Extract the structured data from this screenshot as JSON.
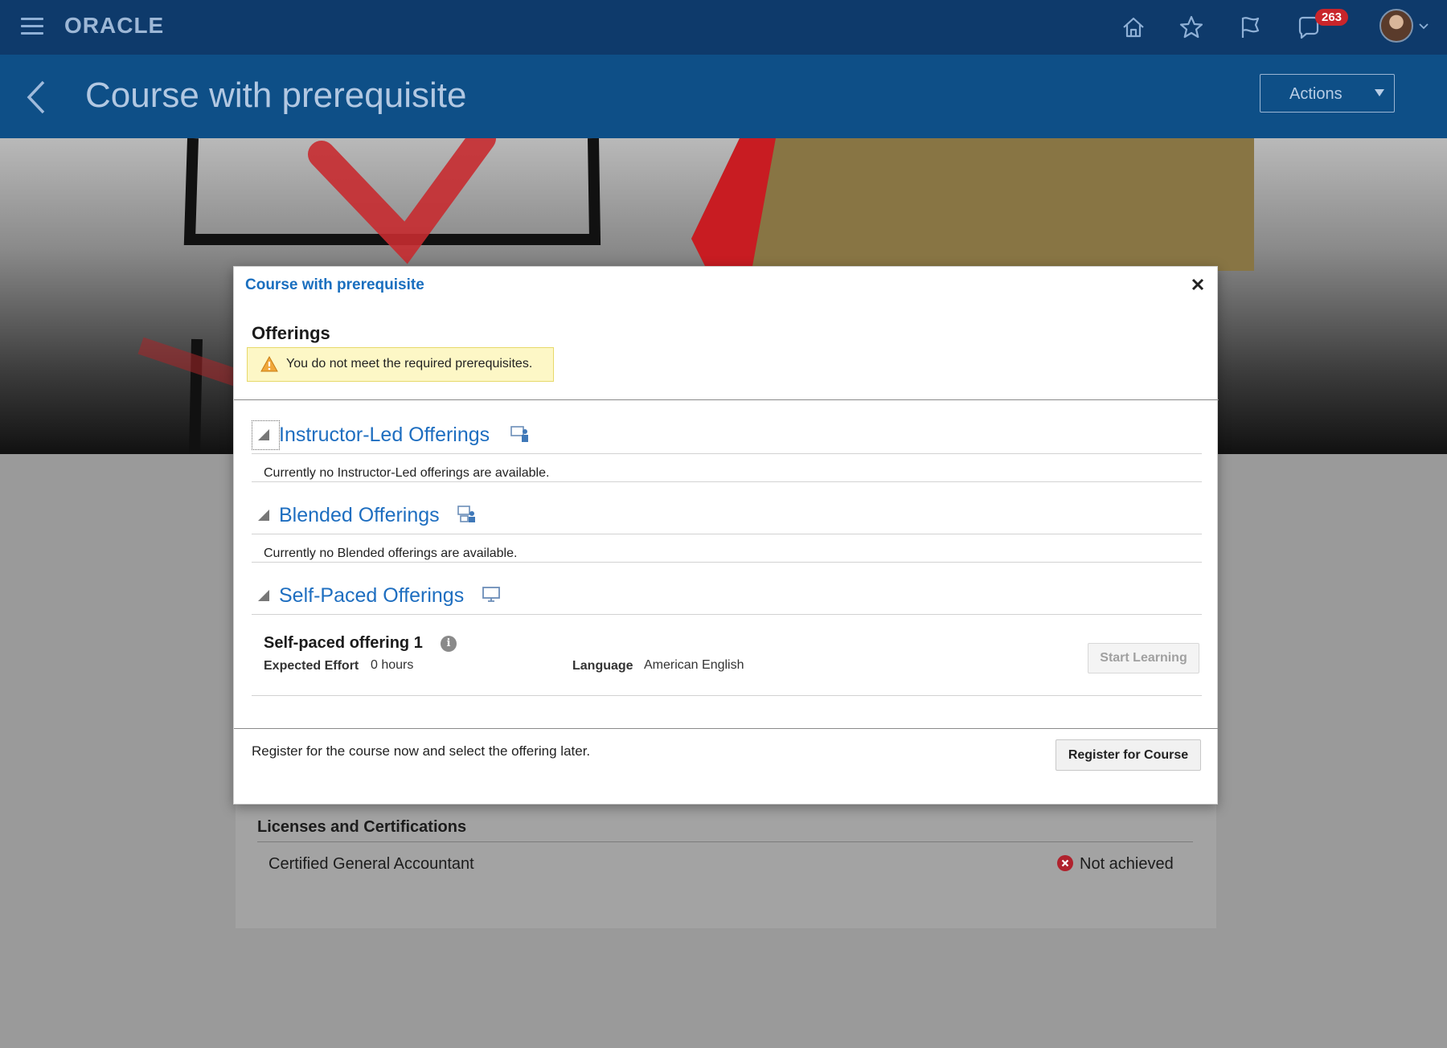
{
  "header": {
    "logo": "ORACLE",
    "notification_count": "263",
    "icons": [
      "menu-icon",
      "home-icon",
      "star-icon",
      "flag-icon",
      "notifications-icon",
      "avatar",
      "chevron-down-icon"
    ]
  },
  "titlebar": {
    "title": "Course with prerequisite",
    "actions_label": "Actions"
  },
  "background_content": {
    "licenses_heading": "Licenses and Certifications",
    "certification_name": "Certified General Accountant",
    "certification_status": "Not achieved"
  },
  "modal": {
    "title": "Course with prerequisite",
    "offerings_heading": "Offerings",
    "warning": "You do not meet the required prerequisites.",
    "sections": [
      {
        "title": "Instructor-Led Offerings",
        "message": "Currently no Instructor-Led offerings are available."
      },
      {
        "title": "Blended Offerings",
        "message": "Currently no Blended offerings are available."
      },
      {
        "title": "Self-Paced Offerings"
      }
    ],
    "offering": {
      "name": "Self-paced offering 1",
      "effort_label": "Expected Effort",
      "effort_value": "0 hours",
      "language_label": "Language",
      "language_value": "American English",
      "start_label": "Start Learning"
    },
    "register_text": "Register for the course now and select the offering later.",
    "register_label": "Register for Course"
  },
  "colors": {
    "header_bg": "#0e3a6b",
    "titlebar_bg": "#0e4f87",
    "link_blue": "#1e6ec0",
    "badge_red": "#c9252b",
    "warning_bg": "#fdf7c6"
  }
}
